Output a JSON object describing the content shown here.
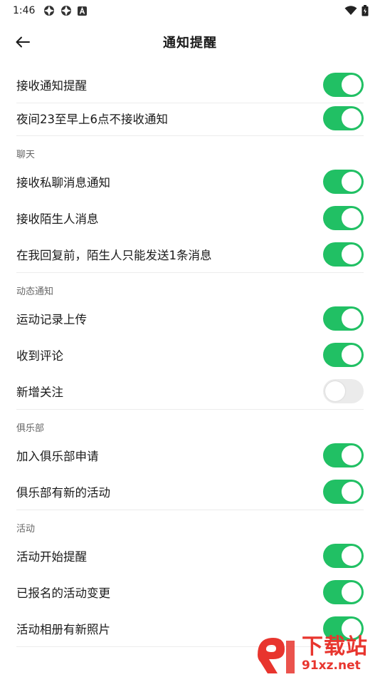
{
  "status_bar": {
    "time": "1:46",
    "icons": [
      "aperture-icon",
      "aperture-icon",
      "a-box-icon"
    ],
    "right_icons": [
      "wifi-icon",
      "battery-icon"
    ]
  },
  "header": {
    "title": "通知提醒",
    "back_icon": "arrow-left-icon"
  },
  "colors": {
    "toggle_on": "#21c064",
    "toggle_off": "#ebebeb",
    "section_text": "#666666"
  },
  "general": {
    "items": [
      {
        "label": "接收通知提醒",
        "on": true
      },
      {
        "label": "夜间23至早上6点不接收通知",
        "on": true
      }
    ]
  },
  "sections": [
    {
      "title": "聊天",
      "items": [
        {
          "label": "接收私聊消息通知",
          "on": true
        },
        {
          "label": "接收陌生人消息",
          "on": true
        },
        {
          "label": "在我回复前，陌生人只能发送1条消息",
          "on": true
        }
      ]
    },
    {
      "title": "动态通知",
      "items": [
        {
          "label": "运动记录上传",
          "on": true
        },
        {
          "label": "收到评论",
          "on": true
        },
        {
          "label": "新增关注",
          "on": false
        }
      ]
    },
    {
      "title": "俱乐部",
      "items": [
        {
          "label": "加入俱乐部申请",
          "on": true
        },
        {
          "label": "俱乐部有新的活动",
          "on": true
        }
      ]
    },
    {
      "title": "活动",
      "items": [
        {
          "label": "活动开始提醒",
          "on": true
        },
        {
          "label": "已报名的活动变更",
          "on": true
        },
        {
          "label": "活动相册有新照片",
          "on": true
        }
      ]
    }
  ],
  "watermark": {
    "text": "下载站",
    "url": "91xz.net"
  }
}
